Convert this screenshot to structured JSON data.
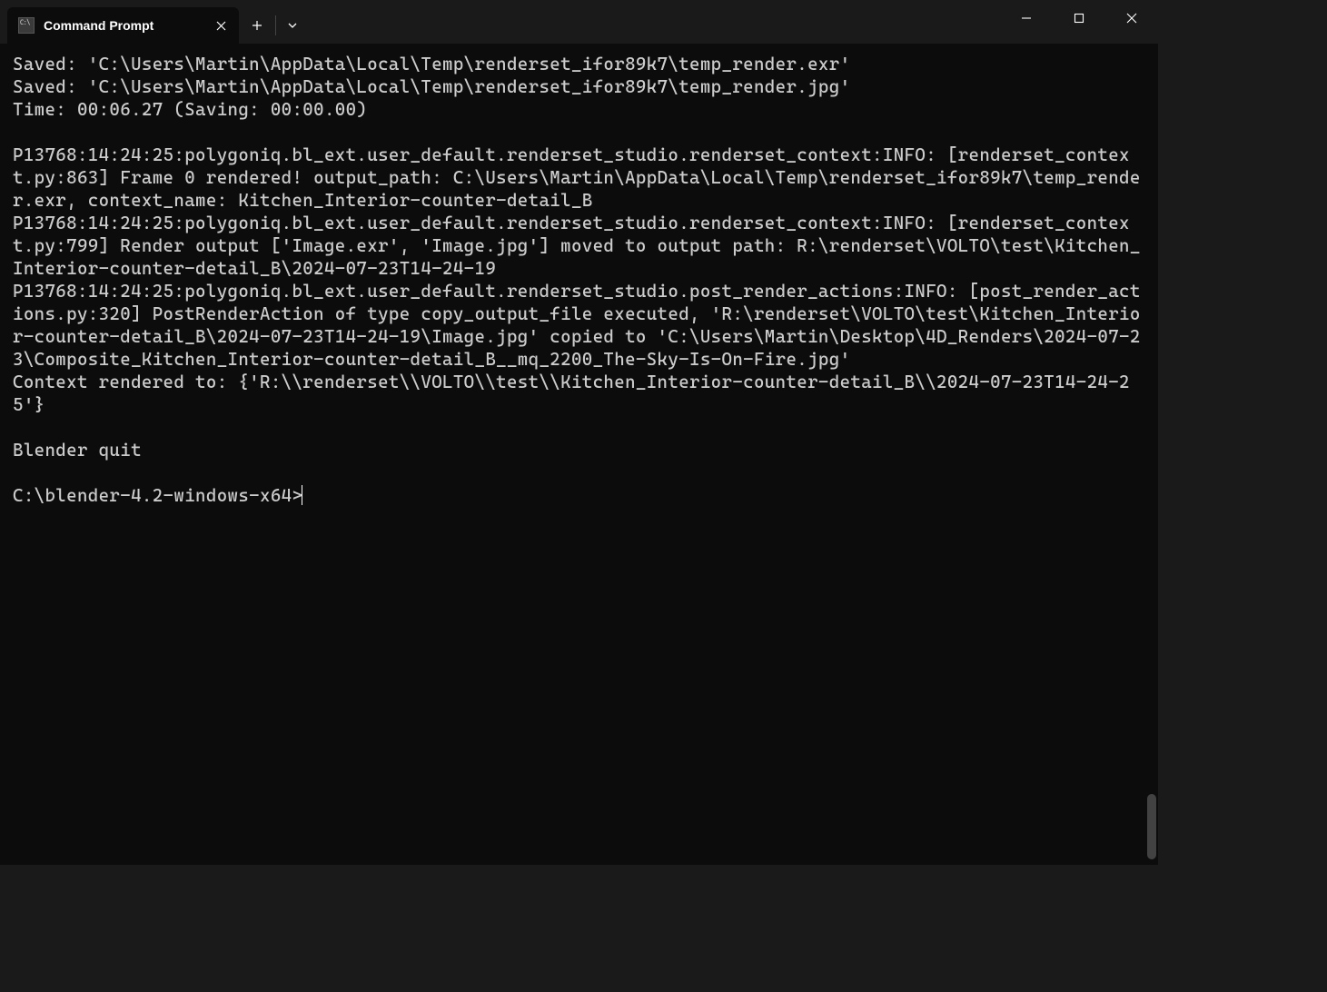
{
  "tab": {
    "title": "Command Prompt"
  },
  "terminal": {
    "lines": [
      "Saved: 'C:\\Users\\Martin\\AppData\\Local\\Temp\\renderset_ifor89k7\\temp_render.exr'",
      "Saved: 'C:\\Users\\Martin\\AppData\\Local\\Temp\\renderset_ifor89k7\\temp_render.jpg'",
      "Time: 00:06.27 (Saving: 00:00.00)",
      "",
      "P13768:14:24:25:polygoniq.bl_ext.user_default.renderset_studio.renderset_context:INFO: [renderset_context.py:863] Frame 0 rendered! output_path: C:\\Users\\Martin\\AppData\\Local\\Temp\\renderset_ifor89k7\\temp_render.exr, context_name: Kitchen_Interior-counter-detail_B",
      "P13768:14:24:25:polygoniq.bl_ext.user_default.renderset_studio.renderset_context:INFO: [renderset_context.py:799] Render output ['Image.exr', 'Image.jpg'] moved to output path: R:\\renderset\\VOLTO\\test\\Kitchen_Interior-counter-detail_B\\2024-07-23T14-24-19",
      "P13768:14:24:25:polygoniq.bl_ext.user_default.renderset_studio.post_render_actions:INFO: [post_render_actions.py:320] PostRenderAction of type copy_output_file executed, 'R:\\renderset\\VOLTO\\test\\Kitchen_Interior-counter-detail_B\\2024-07-23T14-24-19\\Image.jpg' copied to 'C:\\Users\\Martin\\Desktop\\4D_Renders\\2024-07-23\\Composite_Kitchen_Interior-counter-detail_B__mq_2200_The-Sky-Is-On-Fire.jpg'",
      "Context rendered to: {'R:\\\\renderset\\\\VOLTO\\\\test\\\\Kitchen_Interior-counter-detail_B\\\\2024-07-23T14-24-25'}",
      "",
      "Blender quit",
      ""
    ],
    "prompt": "C:\\blender-4.2-windows-x64>"
  }
}
